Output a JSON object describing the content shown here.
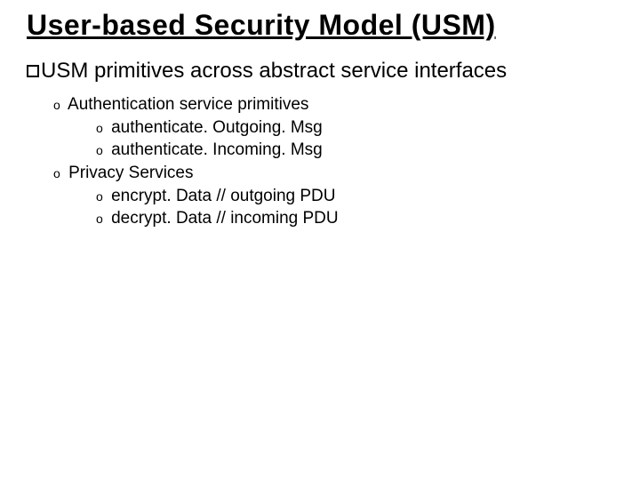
{
  "title": "User-based Security Model (USM)",
  "lead_prefix": "USM",
  "lead_rest": " primitives across abstract service interfaces",
  "body": {
    "sec1": "Authentication service primitives",
    "sec1_items": {
      "a": "authenticate. Outgoing. Msg",
      "b": "authenticate. Incoming. Msg"
    },
    "sec2": "Privacy Services",
    "sec2_items": {
      "a": "encrypt. Data  // outgoing PDU",
      "b": "decrypt. Data  // incoming PDU"
    }
  }
}
